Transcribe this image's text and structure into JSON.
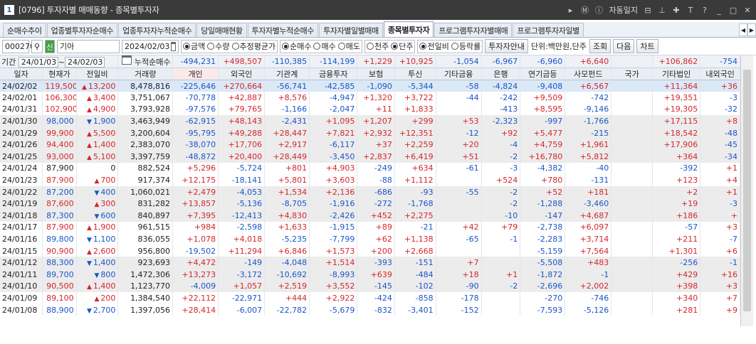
{
  "window": {
    "num": "1",
    "title": "[0796] 투자자별 매매동향 - 종목별투자자",
    "right": [
      "자동일지"
    ]
  },
  "tabs": [
    "순매수추이",
    "업종별투자자순매수",
    "업종투자자누적순매수",
    "당일매매현황",
    "투자자별누적순매수",
    "투자자별일별매매",
    "종목별투자자",
    "프로그램투자자별매매",
    "프로그램투자자일별"
  ],
  "active_tab": 6,
  "toolbar": {
    "code": "000270",
    "badge": "신",
    "name": "기아",
    "date": "2024/02/03",
    "radios1": [
      "금액",
      "수량",
      "추정평균가"
    ],
    "radios2": [
      "순매수",
      "매수",
      "매도"
    ],
    "radios3": [
      "천주",
      "단주"
    ],
    "radios4": [
      "전일비",
      "등락률"
    ],
    "btn_guide": "투자자안내",
    "unit": "단위:백만원,단주",
    "btn_query": "조회",
    "btn_next": "다음",
    "btn_chart": "차트"
  },
  "period": {
    "label": "기간",
    "from": "24/01/03",
    "to": "24/02/03",
    "sum_label": "누적순매수"
  },
  "sums": [
    "-494,231",
    "+498,507",
    "-110,385",
    "-114,199",
    "+1,229",
    "+10,925",
    "-1,054",
    "-6,967",
    "-6,960",
    "+6,640",
    "",
    "+106,862",
    "-754"
  ],
  "headers": [
    "일자",
    "현재가",
    "전일비",
    "거래량",
    "개인",
    "외국인",
    "기관계",
    "금융투자",
    "보험",
    "투신",
    "기타금융",
    "은행",
    "연기금등",
    "사모펀드",
    "국가",
    "기타법인",
    "내외국인"
  ],
  "rows": [
    [
      "24/02/02",
      "119,500",
      "u",
      "13,200",
      "8,478,816",
      "-225,646",
      "+270,664",
      "-56,741",
      "-42,585",
      "-1,090",
      "-5,344",
      "-58",
      "-4,824",
      "-9,408",
      "+6,567",
      "",
      "+11,364",
      "+36"
    ],
    [
      "24/02/01",
      "106,300",
      "u",
      "3,400",
      "3,751,067",
      "-70,778",
      "+42,887",
      "+8,576",
      "-4,947",
      "+1,320",
      "+3,722",
      "-44",
      "-242",
      "+9,509",
      "-742",
      "",
      "+19,351",
      "-3"
    ],
    [
      "24/01/31",
      "102,900",
      "u",
      "4,900",
      "3,793,928",
      "-97,576",
      "+79,765",
      "-1,166",
      "-2,047",
      "+11",
      "+1,833",
      "",
      "-413",
      "+8,595",
      "-9,146",
      "",
      "+19,305",
      "-32"
    ],
    [
      "24/01/30",
      "98,000",
      "d",
      "1,900",
      "3,463,949",
      "-62,915",
      "+48,143",
      "-2,431",
      "+1,095",
      "+1,207",
      "+299",
      "+53",
      "-2,323",
      "-997",
      "-1,766",
      "",
      "+17,115",
      "+8"
    ],
    [
      "24/01/29",
      "99,900",
      "u",
      "5,500",
      "3,200,604",
      "-95,795",
      "+49,288",
      "+28,447",
      "+7,821",
      "+2,932",
      "+12,351",
      "-12",
      "+92",
      "+5,477",
      "-215",
      "",
      "+18,542",
      "-48"
    ],
    [
      "24/01/26",
      "94,400",
      "u",
      "1,400",
      "2,383,070",
      "-38,070",
      "+17,706",
      "+2,917",
      "-6,117",
      "+37",
      "+2,259",
      "+20",
      "-4",
      "+4,759",
      "+1,961",
      "",
      "+17,906",
      "-45"
    ],
    [
      "24/01/25",
      "93,000",
      "u",
      "5,100",
      "3,397,759",
      "-48,872",
      "+20,400",
      "+28,449",
      "-3,450",
      "+2,837",
      "+6,419",
      "+51",
      "-2",
      "+16,780",
      "+5,812",
      "",
      "+364",
      "-34"
    ],
    [
      "24/01/24",
      "87,900",
      "z",
      "0",
      "882,524",
      "+5,296",
      "-5,724",
      "+801",
      "+4,903",
      "-249",
      "+634",
      "-61",
      "-3",
      "-4,382",
      "-40",
      "",
      "-392",
      "+1"
    ],
    [
      "24/01/23",
      "87,900",
      "u",
      "700",
      "917,374",
      "+12,175",
      "-18,141",
      "+5,801",
      "+3,603",
      "-88",
      "+1,112",
      "",
      "+524",
      "+780",
      "-131",
      "",
      "+123",
      "+4"
    ],
    [
      "24/01/22",
      "87,200",
      "d",
      "400",
      "1,060,021",
      "+2,479",
      "-4,053",
      "+1,534",
      "+2,136",
      "-686",
      "-93",
      "-55",
      "-2",
      "+52",
      "+181",
      "",
      "+2",
      "+1"
    ],
    [
      "24/01/19",
      "87,600",
      "u",
      "300",
      "831,282",
      "+13,857",
      "-5,136",
      "-8,705",
      "-1,916",
      "-272",
      "-1,768",
      "",
      "-2",
      "-1,288",
      "-3,460",
      "",
      "+19",
      "-3"
    ],
    [
      "24/01/18",
      "87,300",
      "d",
      "600",
      "840,897",
      "+7,395",
      "-12,413",
      "+4,830",
      "-2,426",
      "+452",
      "+2,275",
      "",
      "-10",
      "-147",
      "+4,687",
      "",
      "+186",
      "+"
    ],
    [
      "24/01/17",
      "87,900",
      "u",
      "1,900",
      "961,515",
      "+984",
      "-2,598",
      "+1,633",
      "-1,915",
      "+89",
      "-21",
      "+42",
      "+79",
      "-2,738",
      "+6,097",
      "",
      "-57",
      "+3"
    ],
    [
      "24/01/16",
      "89,800",
      "d",
      "1,100",
      "836,055",
      "+1,078",
      "+4,018",
      "-5,235",
      "-7,799",
      "+62",
      "+1,138",
      "-65",
      "-1",
      "-2,283",
      "+3,714",
      "",
      "+211",
      "-7"
    ],
    [
      "24/01/15",
      "90,900",
      "u",
      "2,600",
      "956,800",
      "-19,502",
      "+11,294",
      "+6,846",
      "+1,573",
      "+200",
      "+2,668",
      "",
      "",
      "-5,159",
      "+7,564",
      "",
      "+1,301",
      "+6"
    ],
    [
      "24/01/12",
      "88,300",
      "d",
      "1,400",
      "923,693",
      "+4,472",
      "-149",
      "-4,048",
      "+1,514",
      "-393",
      "-151",
      "+7",
      "",
      "-5,508",
      "+483",
      "",
      "-256",
      "-1"
    ],
    [
      "24/01/11",
      "89,700",
      "d",
      "800",
      "1,472,306",
      "+13,273",
      "-3,172",
      "-10,692",
      "-8,993",
      "+639",
      "-484",
      "+18",
      "+1",
      "-1,872",
      "-1",
      "",
      "+429",
      "+16"
    ],
    [
      "24/01/10",
      "90,500",
      "u",
      "1,400",
      "1,123,770",
      "-4,009",
      "+1,057",
      "+2,519",
      "+3,552",
      "-145",
      "-102",
      "-90",
      "-2",
      "-2,696",
      "+2,002",
      "",
      "+398",
      "+3"
    ],
    [
      "24/01/09",
      "89,100",
      "u",
      "200",
      "1,384,540",
      "+22,112",
      "-22,971",
      "+444",
      "+2,922",
      "-424",
      "-858",
      "-178",
      "",
      "-270",
      "-746",
      "",
      "+340",
      "+7"
    ],
    [
      "24/01/08",
      "88,900",
      "d",
      "2,700",
      "1,397,056",
      "+28,414",
      "-6,007",
      "-22,782",
      "-5,679",
      "-832",
      "-3,401",
      "-152",
      "",
      "-7,593",
      "-5,126",
      "",
      "+281",
      "+9"
    ]
  ],
  "colors": {
    "up": "#d6262b",
    "down": "#1a55c9",
    "highlight": "#dbe8f6",
    "shade": "#ececec"
  }
}
